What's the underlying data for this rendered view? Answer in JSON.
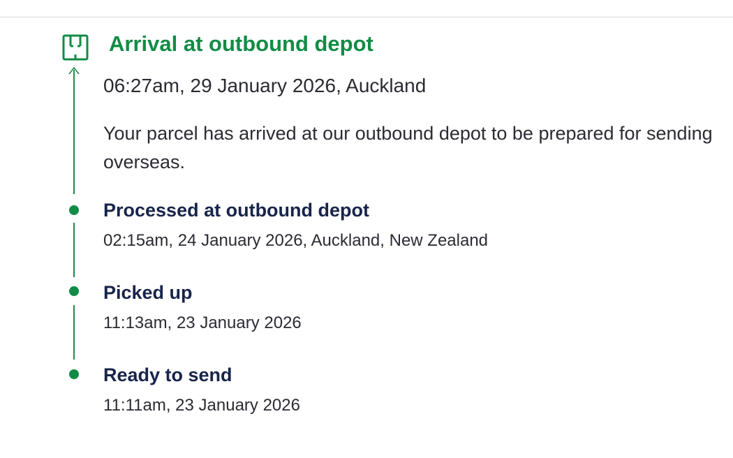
{
  "colors": {
    "accent_green": "#118c45",
    "title_navy": "#18244a",
    "body_text": "#2b2b33"
  },
  "latest_event": {
    "icon": "depot-box-icon",
    "title": "Arrival at outbound depot",
    "time": "06:27am, 29 January 2026, Auckland",
    "description": "Your parcel has arrived at our outbound depot to be prepared for sending overseas."
  },
  "events": [
    {
      "title": "Processed at outbound depot",
      "time": "02:15am, 24 January 2026, Auckland, New Zealand"
    },
    {
      "title": "Picked up",
      "time": "11:13am, 23 January 2026"
    },
    {
      "title": "Ready to send",
      "time": "11:11am, 23 January 2026"
    }
  ]
}
